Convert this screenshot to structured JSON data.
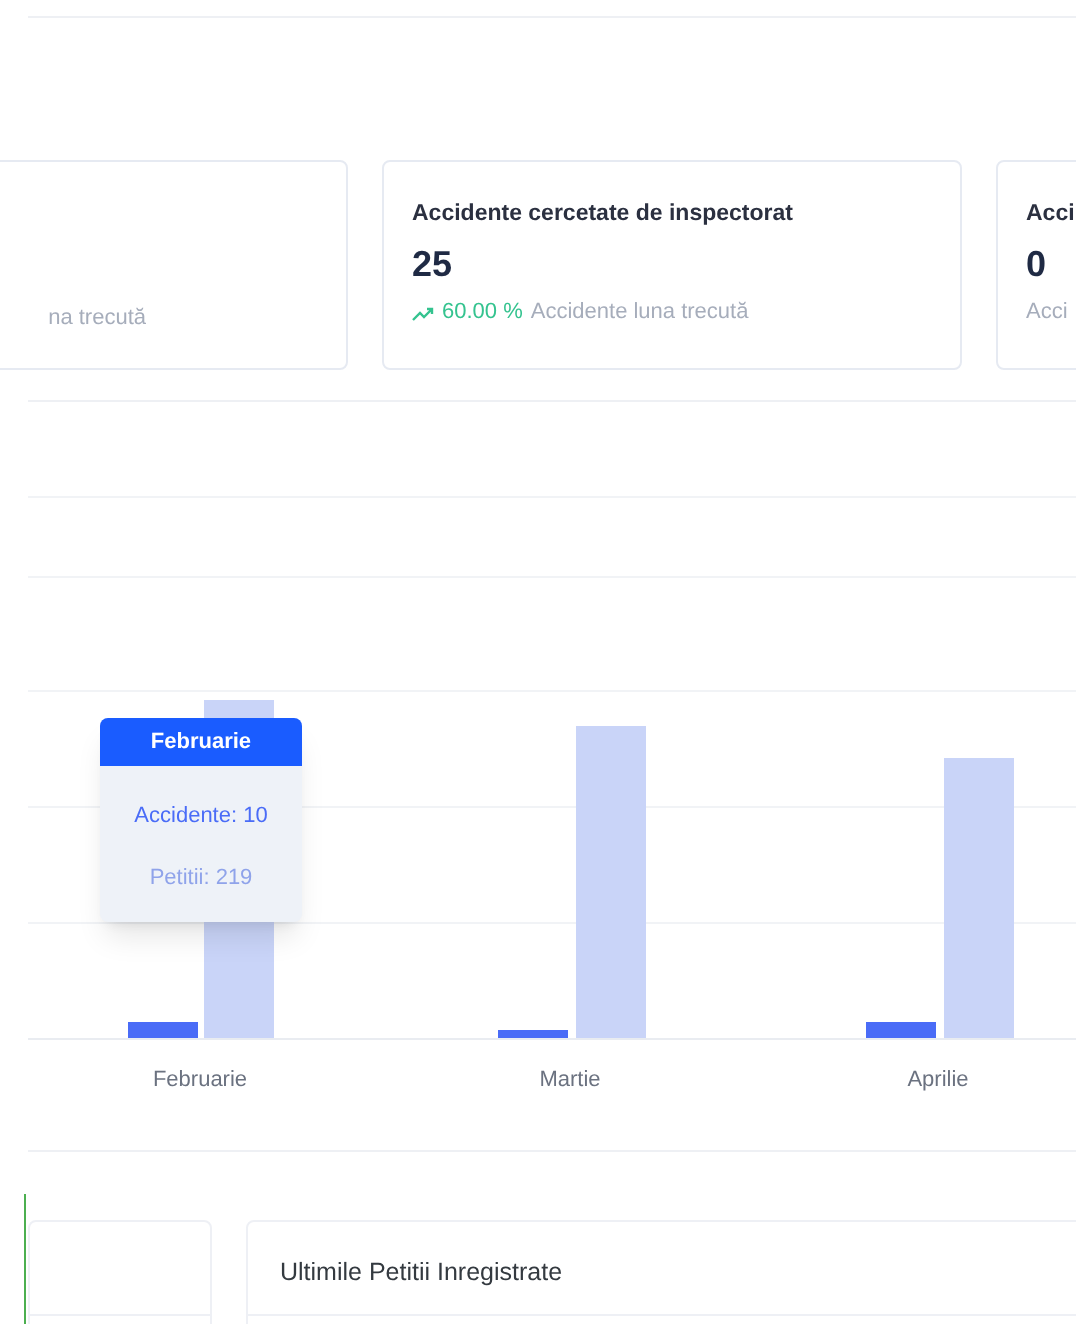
{
  "stat_cards": [
    {
      "subtitle": "na trecută"
    },
    {
      "title": "Accidente cercetate de inspectorat",
      "value": "25",
      "change": "60.00 %",
      "subtitle": "Accidente luna trecută"
    },
    {
      "title": "Acci",
      "value": "0",
      "subtitle": "Acci"
    }
  ],
  "chart": {
    "categories": [
      "Februarie",
      "Martie",
      "Aprilie"
    ],
    "tooltip": {
      "title": "Februarie",
      "lines": [
        "Accidente: 10",
        "Petitii: 219"
      ]
    }
  },
  "panels": [
    {
      "title": "Ultimile Petitii Inregistrate"
    }
  ]
}
